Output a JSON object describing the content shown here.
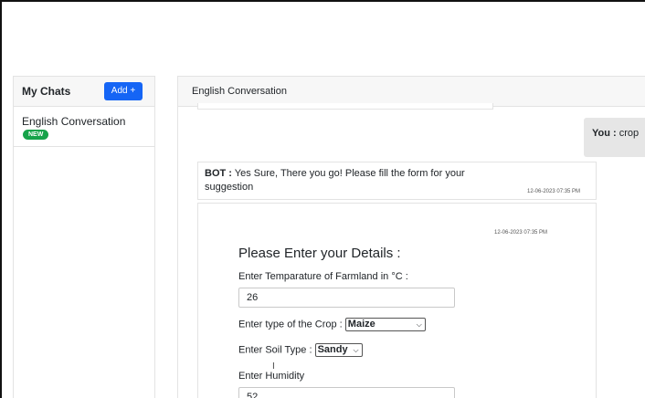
{
  "sidebar": {
    "title": "My Chats",
    "add_label": "Add +",
    "chats": [
      {
        "name": "English Conversation",
        "badge": "NEW"
      }
    ]
  },
  "conversation": {
    "title": "English Conversation",
    "user_message": {
      "speaker": "You :",
      "text": " crop"
    },
    "bot_message": {
      "speaker": "BOT :",
      "text": " Yes Sure, There you go! Please fill the form for your suggestion",
      "timestamp": "12-06-2023 07:35 PM"
    },
    "form": {
      "timestamp": "12-06-2023 07:35 PM",
      "title": "Please Enter your Details :",
      "temperature_label": "Enter Temparature of Farmland in °C :",
      "temperature_value": "26",
      "crop_label": "Enter type of the Crop :",
      "crop_value": "Maize",
      "soil_label": "Enter Soil Type :",
      "soil_value": "Sandy",
      "humidity_label": "Enter Humidity",
      "humidity_value": "52"
    }
  }
}
